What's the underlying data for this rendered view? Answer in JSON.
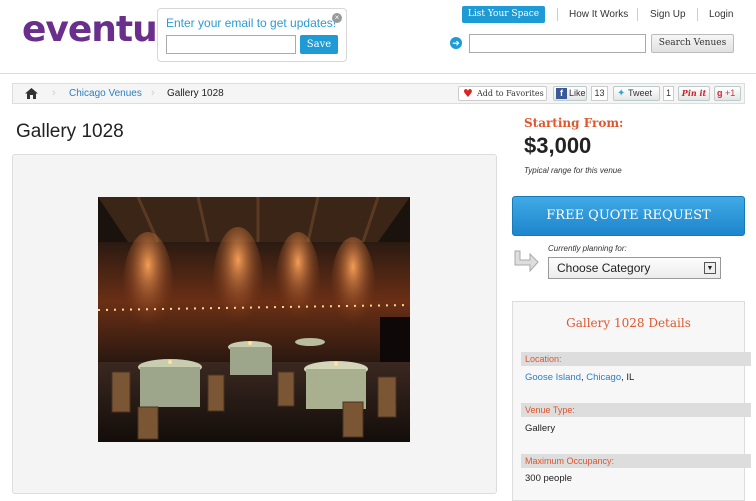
{
  "header": {
    "logo": "eventup",
    "email_signup": {
      "title": "Enter your email to get updates!",
      "button": "Save",
      "placeholder": ""
    },
    "list_space": "List Your Space",
    "nav": [
      "How It Works",
      "Sign Up",
      "Login"
    ],
    "search": {
      "placeholder": "",
      "button": "Search Venues"
    }
  },
  "breadcrumb": {
    "items": [
      "Chicago Venues",
      "Gallery 1028"
    ]
  },
  "social": {
    "favorites": "Add to Favorites",
    "like": "Like",
    "like_count": "13",
    "tweet": "Tweet",
    "tweet_count": "1",
    "pinit": "Pin it",
    "gplus": "+1"
  },
  "venue": {
    "title": "Gallery 1028",
    "price_label": "Starting From:",
    "price": "$3,000",
    "price_note": "Typical range for this venue",
    "quote_button": "FREE QUOTE REQUEST",
    "planning_label": "Currently planning for:",
    "planning_value": "Choose Category"
  },
  "details": {
    "title": "Gallery 1028 Details",
    "location_label": "Location:",
    "location_area": "Goose Island",
    "location_city": "Chicago",
    "location_state": ", IL",
    "type_label": "Venue Type:",
    "type_value": "Gallery",
    "occupancy_label": "Maximum Occupancy:",
    "occupancy_value": "300 people"
  }
}
